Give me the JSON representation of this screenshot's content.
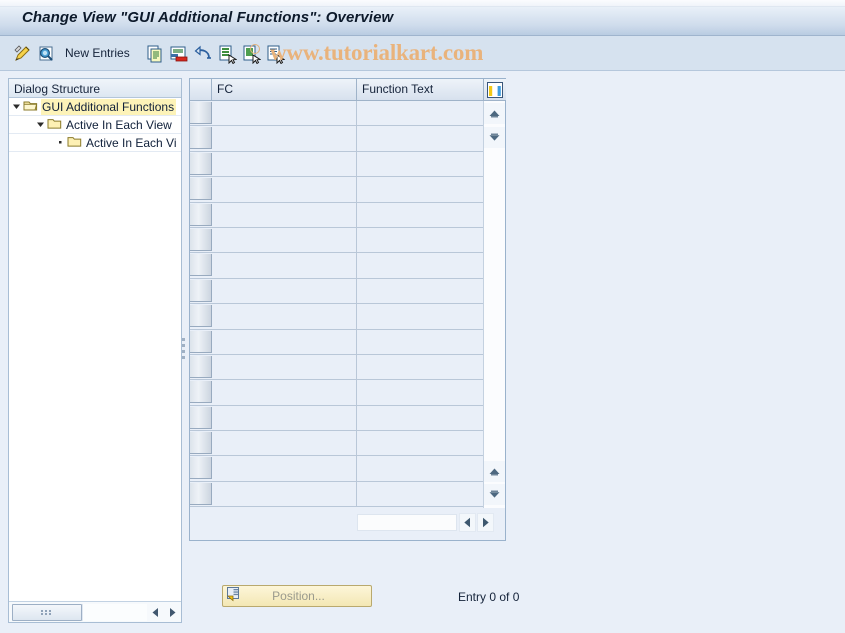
{
  "window": {
    "title": "Change View \"GUI Additional Functions\": Overview"
  },
  "toolbar": {
    "new_entries_label": "New Entries",
    "icons": [
      {
        "name": "edit-pencil-icon"
      },
      {
        "name": "display-magnifier-icon"
      },
      {
        "name": "copy-icon"
      },
      {
        "name": "delete-row-icon"
      },
      {
        "name": "undo-icon"
      },
      {
        "name": "select-all-icon"
      },
      {
        "name": "deselect-all-icon"
      },
      {
        "name": "select-block-icon"
      }
    ]
  },
  "watermark": {
    "text": "www.tutorialkart.com",
    "color": "#e9b37c"
  },
  "tree": {
    "header": "Dialog Structure",
    "items": [
      {
        "label": "GUI Additional Functions",
        "level": 0,
        "expanded": true,
        "selected": true,
        "folder": "open-folder-icon"
      },
      {
        "label": "Active In Each View",
        "level": 1,
        "expanded": true,
        "selected": false,
        "folder": "folder-icon"
      },
      {
        "label": "Active In Each Vi",
        "level": 2,
        "expanded": false,
        "selected": false,
        "folder": "folder-icon"
      }
    ],
    "hscroll": {
      "left_arrow": "scroll-left-icon",
      "right_arrow": "scroll-right-icon"
    }
  },
  "table": {
    "columns": [
      "FC",
      "Function Text"
    ],
    "config_icon": "column-config-icon",
    "row_count": 16,
    "rows": [],
    "scroll": {
      "up": "scroll-up-icon",
      "down": "scroll-down-icon",
      "page_up": "page-up-icon",
      "page_down": "page-down-icon",
      "left": "scroll-left-icon",
      "right": "scroll-right-icon"
    }
  },
  "footer": {
    "position_button_label": "Position...",
    "position_button_icon": "position-icon",
    "position_button_enabled": false,
    "entry_counter": "Entry 0 of 0"
  },
  "colors": {
    "title_bar": "#b9cce2",
    "toolbar": "#d6e2ef",
    "canvas": "#e9eff8",
    "tree_selection": "#fdf3b8",
    "table_cell": "#e9eff8",
    "button_yellow": "#f3e7b4"
  }
}
